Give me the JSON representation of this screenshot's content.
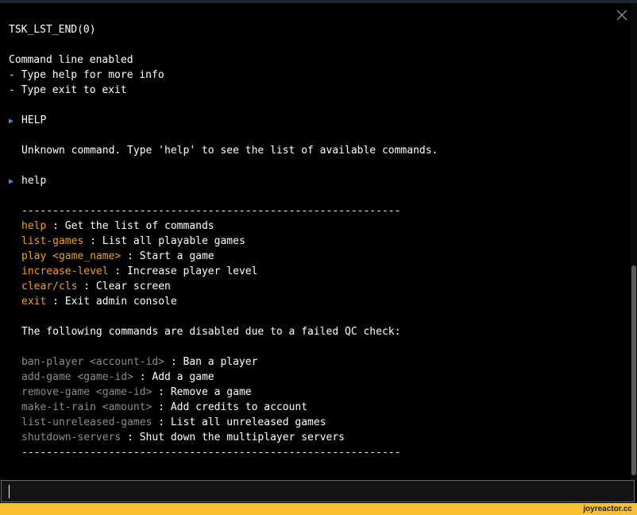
{
  "window": {
    "close_icon": "close-icon"
  },
  "console": {
    "task_end": "TSK_LST_END(0)",
    "intro": [
      "Command line enabled",
      "- Type help for more info",
      "- Type exit to exit"
    ],
    "prompt_icon": "triangle-right-icon",
    "entries": [
      {
        "command": "HELP",
        "response": "Unknown command. Type 'help' to see the list of available commands."
      },
      {
        "command": "help"
      }
    ],
    "separator": "-------------------------------------------------------------",
    "enabled_commands": [
      {
        "name": "help",
        "desc": " : Get the list of commands"
      },
      {
        "name": "list-games",
        "desc": " : List all playable games"
      },
      {
        "name": "play <game_name>",
        "desc": " : Start a game"
      },
      {
        "name": "increase-level",
        "desc": " : Increase player level"
      },
      {
        "name": "clear/cls",
        "desc": " : Clear screen"
      },
      {
        "name": "exit",
        "desc": " : Exit admin console"
      }
    ],
    "disabled_notice": "The following commands are disabled due to a failed QC check:",
    "disabled_commands": [
      {
        "name": "ban-player <account-id>",
        "desc": " : Ban a player"
      },
      {
        "name": "add-game <game-id>",
        "desc": " : Add a game"
      },
      {
        "name": "remove-game <game-id>",
        "desc": " : Remove a game"
      },
      {
        "name": "make-it-rain <amount>",
        "desc": " : Add credits to account"
      },
      {
        "name": "list-unreleased-games",
        "desc": " : List all unreleased games"
      },
      {
        "name": "shutdown-servers",
        "desc": " : Shut down the multiplayer servers"
      }
    ]
  },
  "input": {
    "value": "",
    "placeholder": ""
  },
  "watermark": "joyreactor.cc",
  "colors": {
    "background": "#000000",
    "text": "#ffffff",
    "prompt": "#3d8fe0",
    "enabled_command": "#f0a020",
    "disabled_command": "#8c8c8c",
    "watermark_bar": "#fbc02d"
  }
}
